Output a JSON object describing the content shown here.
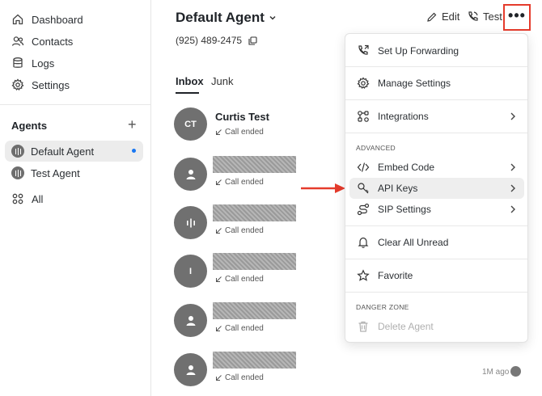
{
  "sidebar": {
    "nav": [
      {
        "label": "Dashboard",
        "icon": "home-icon"
      },
      {
        "label": "Contacts",
        "icon": "contacts-icon"
      },
      {
        "label": "Logs",
        "icon": "database-icon"
      },
      {
        "label": "Settings",
        "icon": "gear-icon"
      }
    ],
    "agents_title": "Agents",
    "add_symbol": "+",
    "agents": [
      {
        "label": "Default Agent",
        "active": true,
        "unread": true
      },
      {
        "label": "Test Agent",
        "active": false,
        "unread": false
      }
    ],
    "all_label": "All"
  },
  "header": {
    "agent_name": "Default Agent",
    "phone": "(925) 489-2475",
    "edit_label": "Edit",
    "test_label": "Test",
    "more_symbol": "•••"
  },
  "tabs": [
    {
      "label": "Inbox",
      "active": true
    },
    {
      "label": "Junk",
      "active": false
    }
  ],
  "conversations": [
    {
      "initials": "CT",
      "name": "Curtis Test",
      "status": "Call ended",
      "avatar": "initials",
      "redacted": false,
      "time": ""
    },
    {
      "initials": "",
      "name": "",
      "status": "Call ended",
      "avatar": "person",
      "redacted": true,
      "time": ""
    },
    {
      "initials": "",
      "name": "",
      "status": "Call ended",
      "avatar": "waveform",
      "redacted": true,
      "time": ""
    },
    {
      "initials": "I",
      "name": "",
      "status": "Call ended",
      "avatar": "initials",
      "redacted": true,
      "time": ""
    },
    {
      "initials": "",
      "name": "",
      "status": "Call ended",
      "avatar": "person",
      "redacted": true,
      "time": ""
    },
    {
      "initials": "",
      "name": "",
      "status": "Call ended",
      "avatar": "person",
      "redacted": true,
      "time": "1M ago"
    }
  ],
  "menu": {
    "items_top": [
      {
        "label": "Set Up Forwarding",
        "icon": "phone-forward-icon",
        "chevron": false
      },
      {
        "label": "Manage Settings",
        "icon": "gear-icon",
        "chevron": false
      },
      {
        "label": "Integrations",
        "icon": "integrations-icon",
        "chevron": true
      }
    ],
    "advanced_title": "ADVANCED",
    "advanced_items": [
      {
        "label": "Embed Code",
        "icon": "code-icon",
        "chevron": true
      },
      {
        "label": "API Keys",
        "icon": "key-icon",
        "chevron": true,
        "highlighted": true
      },
      {
        "label": "SIP Settings",
        "icon": "route-icon",
        "chevron": true
      }
    ],
    "clear_all_unread": "Clear All Unread",
    "favorite": "Favorite",
    "danger_title": "DANGER ZONE",
    "delete_agent": "Delete Agent"
  },
  "colors": {
    "accent_blue": "#1877f2",
    "highlight_red": "#e53b2c",
    "avatar_gray": "#707070"
  }
}
